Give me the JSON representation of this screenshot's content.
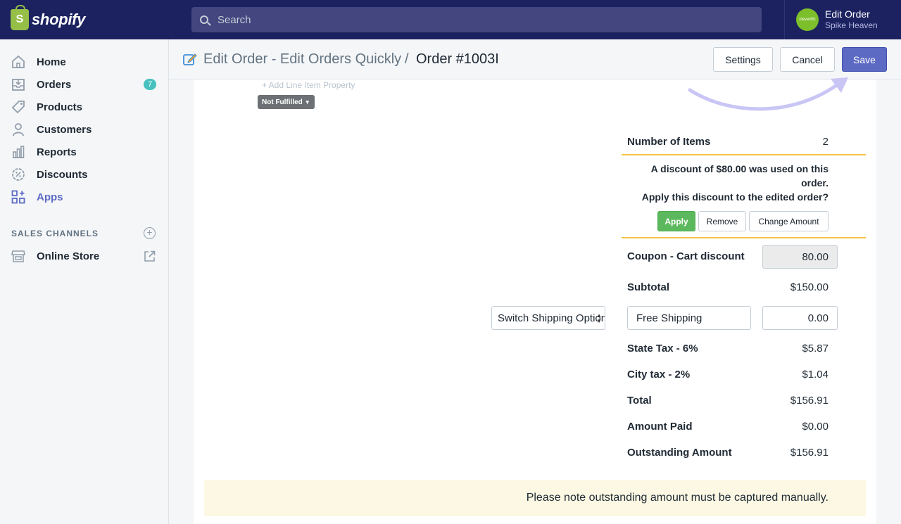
{
  "brand": {
    "name": "shopify"
  },
  "search": {
    "placeholder": "Search"
  },
  "user": {
    "store_name": "Edit Order",
    "shop": "Spike Heaven",
    "avatar_text": "cleverific"
  },
  "sidebar": {
    "items": [
      {
        "label": "Home",
        "icon": "home-icon"
      },
      {
        "label": "Orders",
        "icon": "orders-icon",
        "badge": "7"
      },
      {
        "label": "Products",
        "icon": "tag-icon"
      },
      {
        "label": "Customers",
        "icon": "person-icon"
      },
      {
        "label": "Reports",
        "icon": "bar-chart-icon"
      },
      {
        "label": "Discounts",
        "icon": "discount-icon"
      },
      {
        "label": "Apps",
        "icon": "apps-icon",
        "active": true
      }
    ],
    "sales_channels_title": "SALES CHANNELS",
    "online_store": "Online Store"
  },
  "header": {
    "app_name": "Edit Order - Edit Orders Quickly",
    "separator": "/",
    "order": "Order #1003I",
    "settings_label": "Settings",
    "cancel_label": "Cancel",
    "save_label": "Save"
  },
  "line_item": {
    "add_property": "+ Add Line Item Property",
    "fulfillment_status": "Not Fulfilled"
  },
  "summary": {
    "number_of_items_label": "Number of Items",
    "number_of_items_value": "2",
    "discount_line1": "A discount of $80.00 was used on this order.",
    "discount_line2": "Apply this discount to the edited order?",
    "apply_label": "Apply",
    "remove_label": "Remove",
    "change_amount_label": "Change Amount",
    "coupon_label": "Coupon - Cart discount",
    "coupon_value": "80.00",
    "subtotal_label": "Subtotal",
    "subtotal_value": "$150.00",
    "shipping_select": "Switch Shipping Options",
    "shipping_name": "Free Shipping",
    "shipping_value": "0.00",
    "state_tax_label": "State Tax - 6%",
    "state_tax_value": "$5.87",
    "city_tax_label": "City tax - 2%",
    "city_tax_value": "$1.04",
    "total_label": "Total",
    "total_value": "$156.91",
    "amount_paid_label": "Amount Paid",
    "amount_paid_value": "$0.00",
    "outstanding_label": "Outstanding Amount",
    "outstanding_value": "$156.91"
  },
  "note": {
    "text": "Please note outstanding amount must be captured manually."
  },
  "colors": {
    "topbar": "#1c2260",
    "primary": "#5c6ac4",
    "apply_green": "#5cb85c",
    "divider_yellow": "#f5c243",
    "note_bg": "#fcf8e3"
  }
}
